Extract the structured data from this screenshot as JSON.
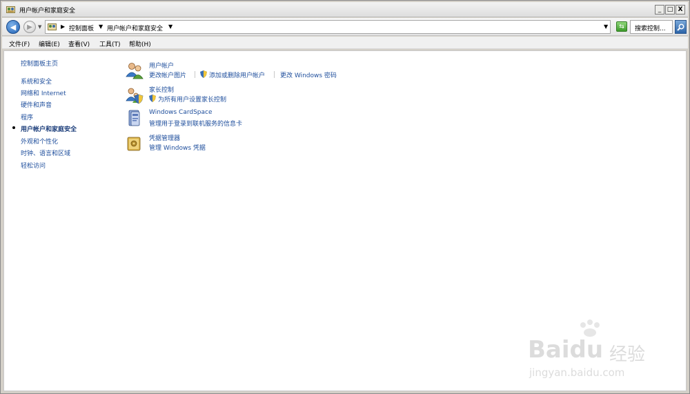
{
  "window": {
    "title": "用户帐户和家庭安全",
    "controls": {
      "minimize": "_",
      "maximize": "□",
      "close": "X"
    }
  },
  "address_bar": {
    "breadcrumbs": [
      "控制面板",
      "用户帐户和家庭安全"
    ],
    "search_placeholder": "搜索控制..."
  },
  "menu": [
    "文件(F)",
    "编辑(E)",
    "查看(V)",
    "工具(T)",
    "帮助(H)"
  ],
  "sidebar": {
    "home": "控制面板主页",
    "items": [
      {
        "label": "系统和安全",
        "current": false
      },
      {
        "label": "网络和 Internet",
        "current": false
      },
      {
        "label": "硬件和声音",
        "current": false
      },
      {
        "label": "程序",
        "current": false
      },
      {
        "label": "用户帐户和家庭安全",
        "current": true
      },
      {
        "label": "外观和个性化",
        "current": false
      },
      {
        "label": "时钟、语言和区域",
        "current": false
      },
      {
        "label": "轻松访问",
        "current": false
      }
    ]
  },
  "categories": [
    {
      "title": "用户帐户",
      "icon": "users-icon",
      "links": [
        "更改帐户图片",
        "添加或删除用户帐户",
        "更改 Windows 密码"
      ]
    },
    {
      "title": "家长控制",
      "icon": "parental-controls-icon",
      "links": [
        "为所有用户设置家长控制"
      ]
    },
    {
      "title": "Windows CardSpace",
      "icon": "cardspace-icon",
      "links": [
        "管理用于登录到联机服务的信息卡"
      ]
    },
    {
      "title": "凭据管理器",
      "icon": "credential-manager-icon",
      "links": [
        "管理 Windows 凭据"
      ]
    }
  ],
  "watermark": {
    "brand": "Baidu",
    "cn": "经验",
    "url": "jingyan.baidu.com"
  }
}
